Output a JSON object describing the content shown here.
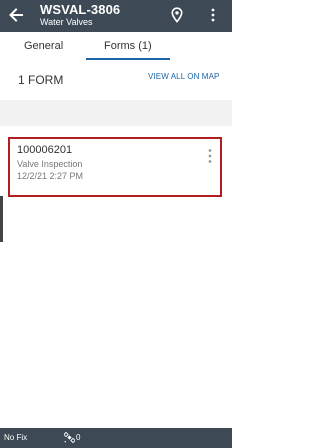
{
  "header": {
    "title": "WSVAL-3806",
    "subtitle": "Water Valves",
    "back_icon": "back-arrow-icon",
    "location_icon": "map-pin-icon",
    "menu_icon": "more-vertical-icon",
    "bg_color": "#3d4a56"
  },
  "tabs": [
    {
      "label": "General",
      "selected": false
    },
    {
      "label": "Forms (1)",
      "selected": true
    }
  ],
  "forms_summary": {
    "count_label": "1 FORM",
    "view_all_label": "VIEW ALL ON MAP"
  },
  "forms": [
    {
      "id": "100006201",
      "name": "Valve Inspection",
      "date": "12/2/21 2:27 PM",
      "menu_icon": "more-vertical-icon",
      "highlight_color": "#b01e1e"
    }
  ],
  "status_bar": {
    "fix_label": "No Fix",
    "satellite_icon": "satellite-icon",
    "satellite_count": "0"
  },
  "colors": {
    "accent": "#1e64a8"
  }
}
